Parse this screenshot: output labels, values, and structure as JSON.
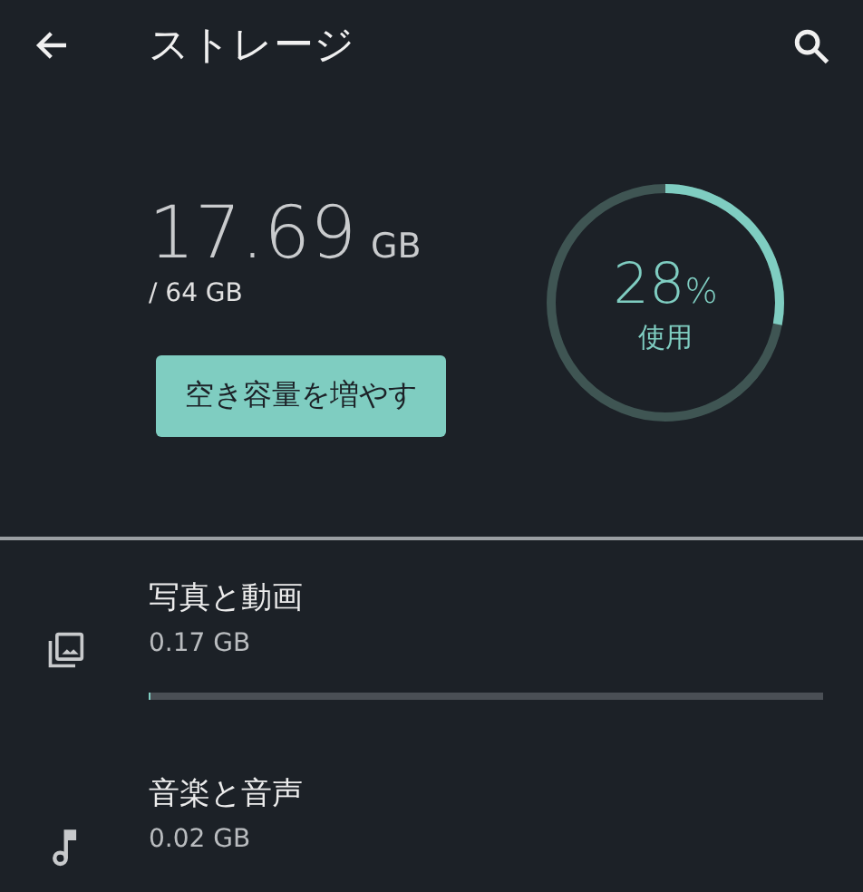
{
  "app_bar": {
    "title": "ストレージ"
  },
  "summary": {
    "used": "17.69",
    "used_unit": "GB",
    "total": "/ 64 GB",
    "button": "空き容量を増やす"
  },
  "gauge": {
    "value": "28",
    "unit": "%",
    "label": "使用"
  },
  "categories": [
    {
      "kind": "photos",
      "title": "写真と動画",
      "size": "0.17 GB",
      "level": 0.003
    },
    {
      "kind": "music",
      "title": "音楽と音声",
      "size": "0.02 GB"
    }
  ]
}
